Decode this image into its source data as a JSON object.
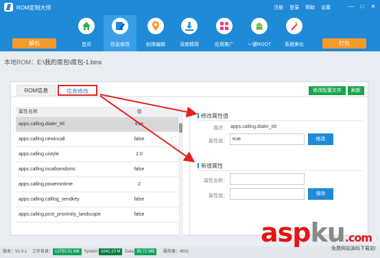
{
  "app": {
    "title": "ROM定制大师"
  },
  "topmenu": [
    "注册",
    "登录",
    "帮助",
    "设置"
  ],
  "window_controls": [
    "—",
    "□",
    "✕"
  ],
  "toolbar": {
    "left_button": "解包",
    "right_button": "打包",
    "items": [
      {
        "label": "首页",
        "icon": "home-icon",
        "active": false
      },
      {
        "label": "信息修改",
        "icon": "edit-icon",
        "active": true
      },
      {
        "label": "权限编辑",
        "icon": "location-icon",
        "active": false
      },
      {
        "label": "深度精简",
        "icon": "download-icon",
        "active": false
      },
      {
        "label": "应用推广",
        "icon": "apps-icon",
        "active": false
      },
      {
        "label": "一键ROOT",
        "icon": "android-icon",
        "active": false
      },
      {
        "label": "系统美化",
        "icon": "magic-icon",
        "active": false
      }
    ]
  },
  "path": {
    "label": "本地ROM：",
    "value": "E:\\我的底包\\底包-1.binx"
  },
  "tabs": {
    "rom_info": "ROM信息",
    "info_edit": "信息修改"
  },
  "actions": {
    "edit_config": "修改配置文件",
    "refresh": "刷新"
  },
  "table": {
    "headers": [
      "属性名称",
      "值"
    ],
    "rows": [
      {
        "name": "apps.calling.dialer_titl",
        "value": "true",
        "selected": true
      },
      {
        "name": "apps.calling.newincall",
        "value": "false",
        "selected": false
      },
      {
        "name": "apps.calling.uistyle",
        "value": "2.0",
        "selected": false
      },
      {
        "name": "apps.calling.incallsendsms",
        "value": "false",
        "selected": false
      },
      {
        "name": "apps.calling.powerontime",
        "value": "2",
        "selected": false
      },
      {
        "name": "apps.calling.calllog_sendkey",
        "value": "false",
        "selected": false
      },
      {
        "name": "apps.calling.post_proximity_landscape",
        "value": "false",
        "selected": false
      }
    ]
  },
  "modify": {
    "title": "修改属性值",
    "desc_label": "描述：",
    "desc_value": "apps.calling.dialer_titl",
    "value_label": "属性值：",
    "value": "true",
    "button": "修改"
  },
  "add": {
    "title": "新增属性",
    "name_label": "属性名称：",
    "value_label": "属性值：",
    "button": "保存"
  },
  "status": {
    "version": "版本：V1.0.1",
    "workdir_label": "工作目录：",
    "workdir_value": "13750.31 MB",
    "system_label": "System:",
    "system_value": "1041.10 M",
    "data_label": "Data:",
    "data_value": "85.72 MB",
    "extra_label": "服务器：",
    "extra_value": "4001"
  },
  "watermark": {
    "main_red": "asp",
    "main_grey": "ku",
    "main_tail": ".com",
    "sub": "免费网站源码下载站!"
  },
  "colors": {
    "primary": "#1f8ad8",
    "orange": "#f39a2b",
    "green": "#18a54c",
    "highlight": "#e81e1e"
  }
}
